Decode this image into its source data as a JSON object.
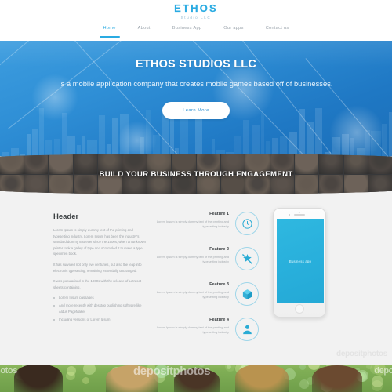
{
  "brand": {
    "logo_main": "ETHOS",
    "logo_sub": "Studio LLC",
    "accent_color": "#2aabe2",
    "hero_blue": "#2f8fd6",
    "icon_cyan": "#29abd4"
  },
  "nav": {
    "items": [
      {
        "label": "Home",
        "active": true
      },
      {
        "label": "About",
        "active": false
      },
      {
        "label": "Business App",
        "active": false
      },
      {
        "label": "Our apps",
        "active": false
      },
      {
        "label": "Contact us",
        "active": false
      }
    ]
  },
  "hero": {
    "title": "ETHOS STUDIOS LLC",
    "subtitle": "is a mobile application company that creates mobile games based off of businesses.",
    "button_label": "Learn More"
  },
  "banner": {
    "text": "BUILD YOUR BUSINESS THROUGH ENGAGEMENT"
  },
  "content": {
    "left": {
      "heading": "Header",
      "paragraphs": [
        "Lorem Ipsum is simply dummy text of the printing and typesetting industry. Lorem Ipsum has been the industry's standard dummy text ever since the 1500s, when an unknown printer took a galley of type and scrambled it to make a type specimen book.",
        "It has survived not only five centuries, but also the leap into electronic typesetting, remaining essentially unchanged.",
        "It was popularised in the 1960s with the release of Letraset sheets containing."
      ],
      "bullets": [
        "Lorem Ipsum passages",
        "And more recently with desktop publishing software like Aldus PageMaker",
        "Including versions of Lorem Ipsum"
      ]
    },
    "features": [
      {
        "title": "Feature 1",
        "text": "Lorem Ipsum is simply dummy text of the printing and typesetting industry",
        "icon": "clock-icon"
      },
      {
        "title": "Feature 2",
        "text": "Lorem Ipsum is simply dummy text of the printing and typesetting industry",
        "icon": "sparkle-icon"
      },
      {
        "title": "Feature 3",
        "text": "Lorem Ipsum is simply dummy text of the printing and typesetting industry",
        "icon": "box-icon"
      },
      {
        "title": "Feature 4",
        "text": "Lorem Ipsum is simply dummy text of the printing and typesetting industry",
        "icon": "user-icon"
      }
    ],
    "phone": {
      "screen_label": "Business app"
    }
  },
  "watermarks": {
    "left": "hotos",
    "center": "depositphotos",
    "right": "depo",
    "top_right": "depositphotos"
  }
}
